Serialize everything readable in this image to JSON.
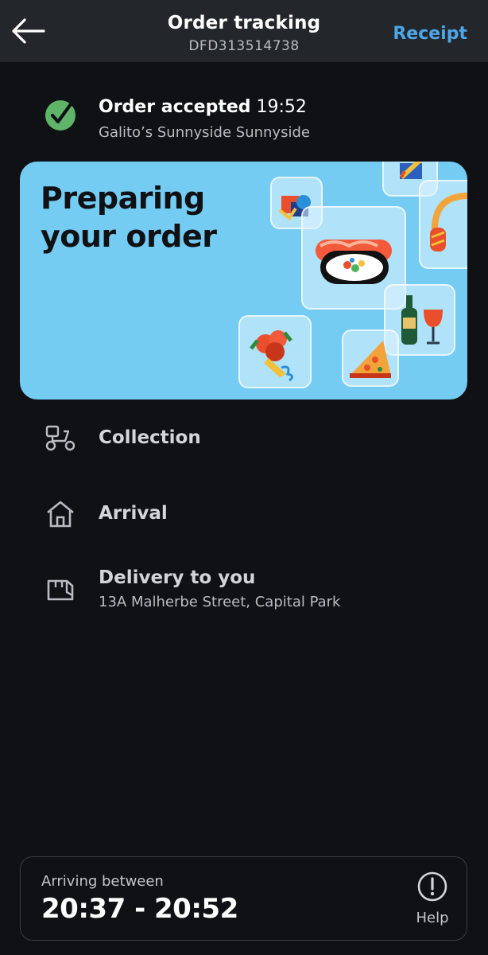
{
  "header": {
    "title": "Order tracking",
    "order_id": "DFD313514738",
    "receipt_label": "Receipt"
  },
  "status": {
    "title": "Order accepted",
    "time": "19:52",
    "restaurant": "Galito’s Sunnyside Sunnyside",
    "check_color": "#5fb46a"
  },
  "banner": {
    "line1": "Preparing",
    "line2": "your order",
    "background": "#74ccf2",
    "tiles": [
      "flowers-icon",
      "sushi-icon",
      "wine-icon",
      "pizza-icon",
      "headphones-icon",
      "pencil-icon",
      "gift-icon"
    ]
  },
  "steps": [
    {
      "label": "Collection",
      "icon": "scooter-icon"
    },
    {
      "label": "Arrival",
      "icon": "home-icon"
    },
    {
      "label": "Delivery to you",
      "address": "13A Malherbe Street, Capital Park",
      "icon": "package-icon"
    }
  ],
  "eta": {
    "label": "Arriving between",
    "time_range": "20:37 - 20:52",
    "help_label": "Help"
  },
  "colors": {
    "accent": "#4da6e6",
    "header_bg": "#23262b",
    "page_bg": "#0f1115"
  }
}
